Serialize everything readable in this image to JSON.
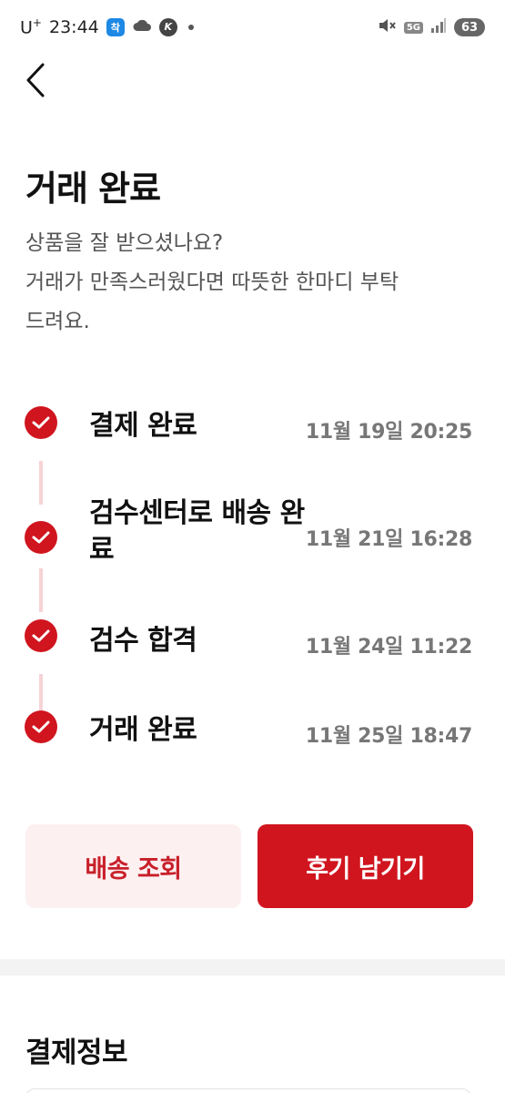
{
  "status_bar": {
    "carrier": "U",
    "carrier_sup": "+",
    "time": "23:44",
    "app_icon_1": "착",
    "app_icon_2": "K",
    "network": "5G",
    "battery": "63"
  },
  "header": {
    "title": "거래 완료",
    "subtitle_lines": [
      "상품을 잘 받으셨나요?",
      "거래가 만족스러웠다면 따뜻한 한마디 부탁",
      "드려요."
    ]
  },
  "timeline": {
    "steps": [
      {
        "label": "결제 완료",
        "time": "11월 19일 20:25"
      },
      {
        "label": "검수센터로 배송 완료",
        "time": "11월 21일 16:28"
      },
      {
        "label": "검수 합격",
        "time": "11월 24일 11:22"
      },
      {
        "label": "거래 완료",
        "time": "11월 25일 18:47"
      }
    ]
  },
  "actions": {
    "tracking_label": "배송 조회",
    "review_label": "후기 남기기"
  },
  "payment_section": {
    "title": "결제정보"
  },
  "colors": {
    "accent": "#d0151f",
    "accent_light": "#fdf0f1",
    "timeline_line": "#f6d3d6"
  }
}
